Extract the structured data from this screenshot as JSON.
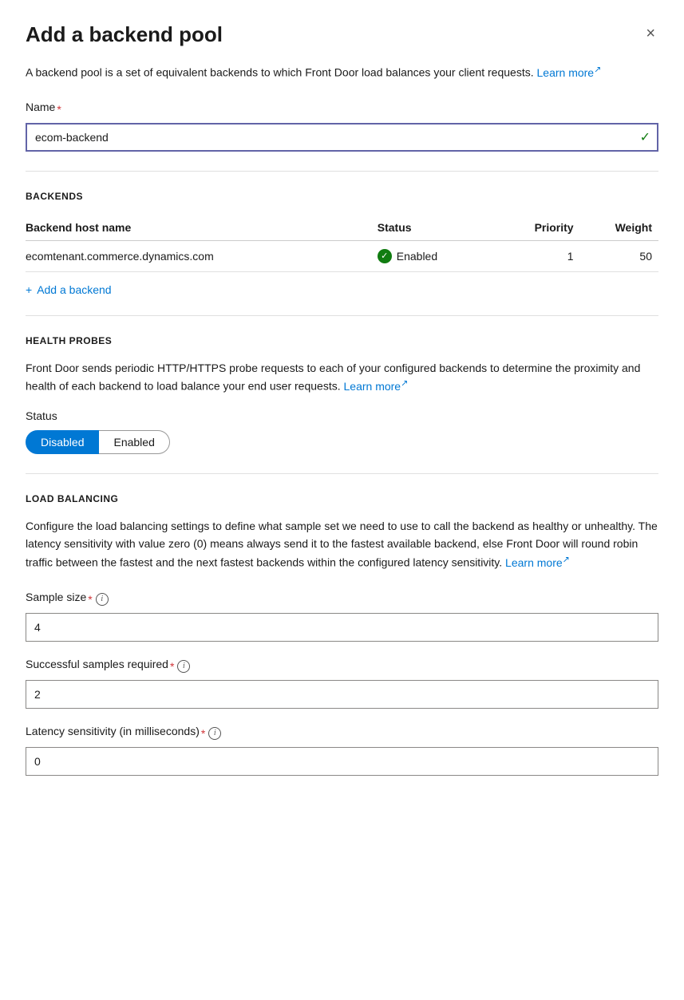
{
  "panel": {
    "title": "Add a backend pool",
    "close_label": "×"
  },
  "description": {
    "text": "A backend pool is a set of equivalent backends to which Front Door load balances your client requests.",
    "learn_more_text": "Learn more",
    "learn_more_icon": "↗"
  },
  "name_field": {
    "label": "Name",
    "required": "*",
    "value": "ecom-backend",
    "checkmark": "✓"
  },
  "backends_section": {
    "heading": "BACKENDS",
    "columns": {
      "host_name": "Backend host name",
      "status": "Status",
      "priority": "Priority",
      "weight": "Weight"
    },
    "rows": [
      {
        "host_name": "ecomtenant.commerce.dynamics.com",
        "status": "Enabled",
        "priority": "1",
        "weight": "50"
      }
    ],
    "add_backend_label": "Add a backend",
    "add_icon": "+"
  },
  "health_probes_section": {
    "heading": "HEALTH PROBES",
    "description": "Front Door sends periodic HTTP/HTTPS probe requests to each of your configured backends to determine the proximity and health of each backend to load balance your end user requests.",
    "learn_more_text": "Learn more",
    "learn_more_icon": "↗",
    "status_label": "Status",
    "toggle": {
      "disabled_label": "Disabled",
      "enabled_label": "Enabled",
      "active": "disabled"
    }
  },
  "load_balancing_section": {
    "heading": "LOAD BALANCING",
    "description": "Configure the load balancing settings to define what sample set we need to use to call the backend as healthy or unhealthy. The latency sensitivity with value zero (0) means always send it to the fastest available backend, else Front Door will round robin traffic between the fastest and the next fastest backends within the configured latency sensitivity.",
    "learn_more_text": "Learn more",
    "learn_more_icon": "↗",
    "sample_size": {
      "label": "Sample size",
      "required": "*",
      "value": "4"
    },
    "successful_samples": {
      "label": "Successful samples required",
      "required": "*",
      "value": "2"
    },
    "latency_sensitivity": {
      "label": "Latency sensitivity (in milliseconds)",
      "required": "*",
      "value": "0"
    }
  }
}
